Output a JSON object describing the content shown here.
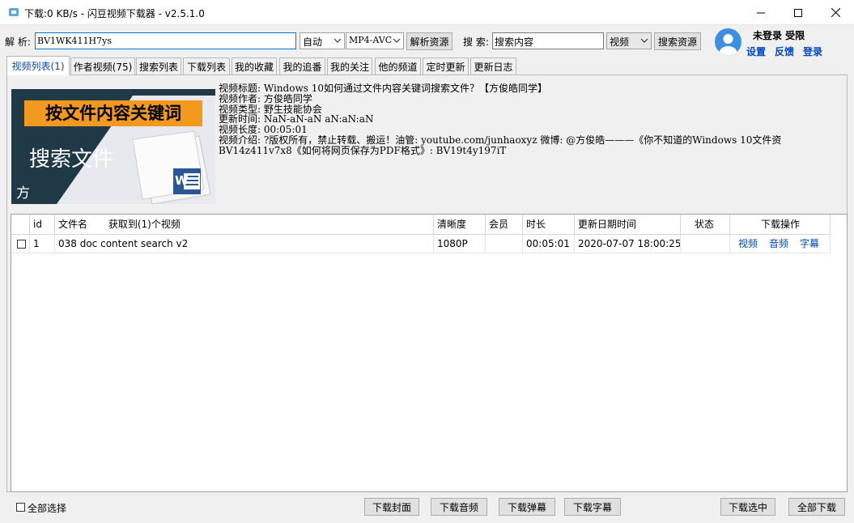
{
  "window": {
    "title": "下载:0 KB/s - 闪豆视频下载器 - v2.5.1.0",
    "minimize": "—",
    "maximize": "☐",
    "close": "✕"
  },
  "parse": {
    "label": "解 析:",
    "input_value": "BV1WK411H7ys",
    "quality_option": "自动",
    "format_option": "MP4-AVC",
    "button": "解析资源"
  },
  "search": {
    "label": "搜 索:",
    "input_value": "搜索内容",
    "type_option": "视频",
    "button": "搜索资源"
  },
  "user": {
    "status": "未登录 受限",
    "settings": "设置",
    "feedback": "反馈",
    "login": "登录"
  },
  "tabs": [
    {
      "label": "视频列表(1)",
      "active": true
    },
    {
      "label": "作者视频(75)"
    },
    {
      "label": "搜索列表"
    },
    {
      "label": "下载列表"
    },
    {
      "label": "我的收藏"
    },
    {
      "label": "我的追番"
    },
    {
      "label": "我的关注"
    },
    {
      "label": "他的频道"
    },
    {
      "label": "定时更新"
    },
    {
      "label": "更新日志"
    }
  ],
  "thumbnail": {
    "headline": "按文件内容关键词",
    "subtitle": "搜索文件",
    "corner_char": "方",
    "doc_letter": "W"
  },
  "info_lines": [
    "视频标题: Windows 10如何通过文件内容关键词搜索文件？【方俊皓同学】",
    "视频作者: 方俊皓同学",
    "视频类型: 野生技能协会",
    "更新时间: NaN-aN-aN aN:aN:aN",
    "视频长度: 00:05:01",
    "视频介绍: ?版权所有，禁止转载、搬运！油管: youtube.com/junhaoxyz 微博: @方俊皓———《你不知道的Windows 10文件资",
    "BV14z411v7x8《如何将网页保存为PDF格式》: BV19t4y197iT"
  ],
  "table": {
    "headers": {
      "id": "id",
      "filename": "文件名",
      "count": "获取到(1)个视频",
      "quality": "清晰度",
      "member": "会员",
      "duration": "时长",
      "updated": "更新日期时间",
      "status": "状态",
      "actions": "下载操作"
    },
    "rows": [
      {
        "id": "1",
        "filename": "038 doc content search v2",
        "quality": "1080P",
        "member": "",
        "duration": "00:05:01",
        "updated": "2020-07-07 18:00:25",
        "status": "",
        "action_video": "视频",
        "action_audio": "音频",
        "action_subtitle": "字幕"
      }
    ]
  },
  "bottom": {
    "select_all": "全部选择",
    "dl_cover": "下载封面",
    "dl_audio": "下载音频",
    "dl_danmaku": "下载弹幕",
    "dl_subtitle": "下载字幕",
    "dl_selected": "下载选中",
    "dl_all": "全部下载"
  },
  "colors": {
    "accent": "#0078d7",
    "link": "#0047c4",
    "thumb_orange": "#f39a1e",
    "thumb_dark": "#1f3a46"
  }
}
